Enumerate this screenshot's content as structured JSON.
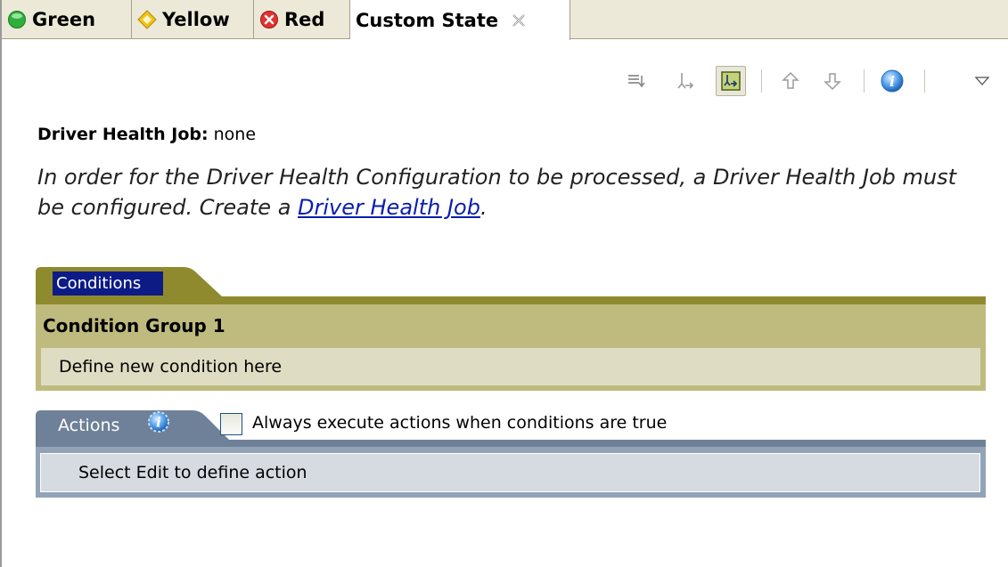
{
  "tabs": [
    {
      "label": "Green",
      "icon": "green-circle-icon",
      "color": "#2fae3a"
    },
    {
      "label": "Yellow",
      "icon": "yellow-diamond-icon",
      "color": "#f2c318"
    },
    {
      "label": "Red",
      "icon": "red-x-circle-icon",
      "color": "#e0322f"
    },
    {
      "label": "Custom State",
      "icon": "close-icon",
      "active": true
    }
  ],
  "toolbar": {
    "buttons": [
      {
        "name": "collapse-all-icon"
      },
      {
        "name": "tree-structure-icon"
      },
      {
        "name": "tree-toggle-icon",
        "pressed": true
      },
      {
        "name": "move-up-icon"
      },
      {
        "name": "move-down-icon"
      },
      {
        "name": "info-icon"
      },
      {
        "name": "view-menu-icon"
      }
    ]
  },
  "job": {
    "label": "Driver Health Job:",
    "value": "none"
  },
  "message": {
    "text": "In order for the Driver Health Configuration to be processed, a Driver Health Job must be configured. Create a ",
    "link": "Driver Health Job",
    "suffix": "."
  },
  "conditions": {
    "tab_label": "Conditions",
    "group_title": "Condition Group 1",
    "placeholder": "Define new condition here"
  },
  "actions": {
    "tab_label": "Actions",
    "checkbox_label": "Always execute actions when conditions are true",
    "checkbox_checked": false,
    "placeholder": "Select Edit to define action"
  },
  "colors": {
    "conditions_accent": "#8f8a2e",
    "actions_accent": "#6e8198",
    "link": "#0a1eaf"
  }
}
